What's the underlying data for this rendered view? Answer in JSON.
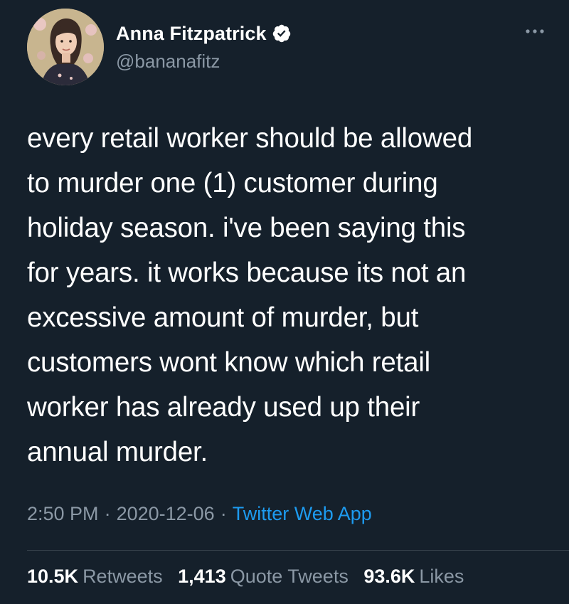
{
  "author": {
    "display_name": "Anna Fitzpatrick",
    "handle": "@bananafitz",
    "verified": true,
    "avatar_icon": "profile-avatar-illustration"
  },
  "tweet": {
    "lines": [
      "every retail worker should be allowed",
      "to murder one (1) customer during",
      "holiday season. i've been saying this",
      "for years. it works because its not an",
      "excessive amount of murder, but",
      "customers wont know which retail",
      "worker has already used up their",
      "annual murder."
    ],
    "time": "2:50 PM",
    "separator": "·",
    "date": "2020-12-06",
    "source": "Twitter Web App"
  },
  "stats": {
    "retweets": {
      "value": "10.5K",
      "label": "Retweets"
    },
    "quotes": {
      "value": "1,413",
      "label": "Quote Tweets"
    },
    "likes": {
      "value": "93.6K",
      "label": "Likes"
    }
  },
  "colors": {
    "background": "#15202b",
    "primary_text": "#ffffff",
    "secondary_text": "#8b98a5",
    "link": "#1d9bf0",
    "divider": "#38444d"
  },
  "icons": {
    "verified": "verified-badge-icon",
    "more": "more-options-icon"
  }
}
